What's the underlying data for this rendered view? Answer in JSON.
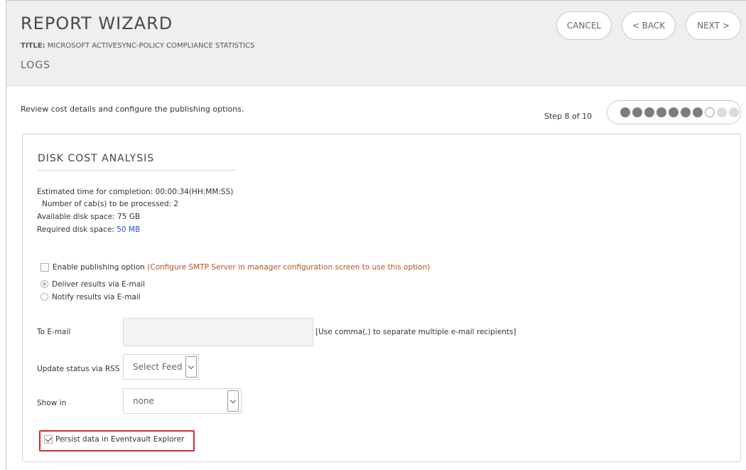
{
  "header": {
    "wizard_title": "REPORT WIZARD",
    "title_prefix": "TITLE:",
    "report_title": "MICROSOFT ACTIVESYNC-POLICY COMPLIANCE STATISTICS",
    "section": "LOGS",
    "buttons": {
      "cancel": "CANCEL",
      "back": "< BACK",
      "next": "NEXT >"
    }
  },
  "step": {
    "instruction": "Review cost details and configure the publishing options.",
    "label": "Step 8 of 10",
    "current": 8,
    "total": 10
  },
  "disk_cost": {
    "heading": "DISK COST ANALYSIS",
    "estimated_time": "Estimated time for completion: 00:00:34(HH:MM:SS)",
    "cabs": "Number of cab(s) to be processed: 2",
    "available": "Available disk space: 75 GB",
    "required_label": "Required disk space: ",
    "required_value": "50 MB"
  },
  "publishing": {
    "enable_label": "Enable publishing option",
    "enable_note": "(Configure SMTP Server in manager configuration screen to use this option)",
    "enable_checked": false,
    "deliver_label": "Deliver results via E-mail",
    "notify_label": "Notify results via E-mail",
    "selected_option": "deliver"
  },
  "form": {
    "to_email_label": "To E-mail",
    "to_email_value": "",
    "to_email_hint": "[Use comma(,) to separate multiple e-mail recipients]",
    "rss_label": "Update status via RSS",
    "rss_value": "Select Feed",
    "show_in_label": "Show in",
    "show_in_value": "none",
    "persist_label": "Persist data in Eventvault Explorer",
    "persist_checked": true
  },
  "colors": {
    "highlight": "#d62a2a",
    "link_blue": "#1a56d6",
    "note_orange": "#b5541c"
  }
}
